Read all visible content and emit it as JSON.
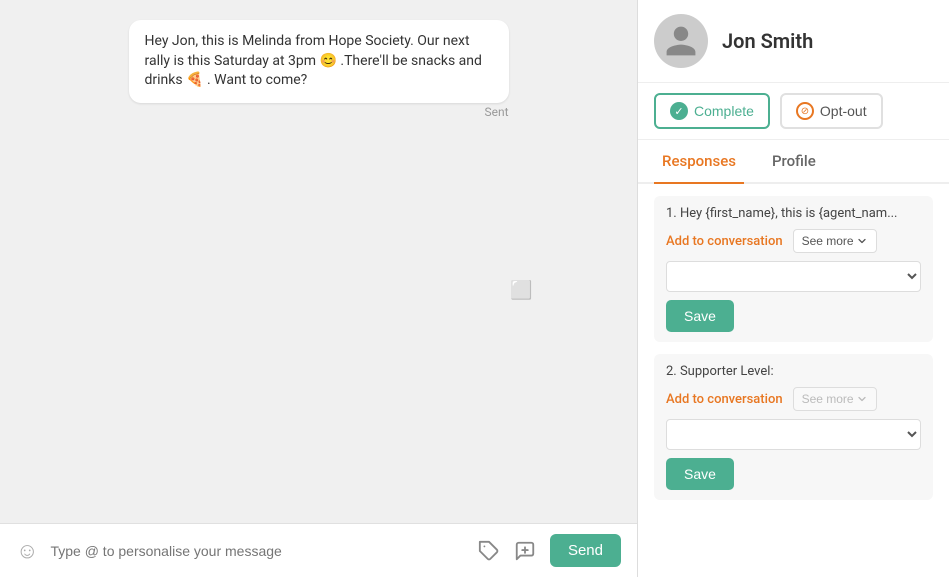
{
  "chat": {
    "message_text": "Hey Jon, this is Melinda from Hope Society. Our next rally is this Saturday at 3pm 😊 .There'll be snacks and drinks 🍕 . Want to come?",
    "sent_label": "Sent",
    "input_placeholder": "Type @ to personalise your message",
    "send_button_label": "Send"
  },
  "contact": {
    "name": "Jon Smith",
    "complete_button_label": "Complete",
    "optout_button_label": "Opt-out"
  },
  "tabs": {
    "responses_label": "Responses",
    "profile_label": "Profile"
  },
  "responses": {
    "item1": {
      "label": "1. Hey {first_name}, this is {agent_nam...",
      "add_to_conversation": "Add to conversation",
      "see_more": "See more",
      "save_label": "Save"
    },
    "item2": {
      "label": "2. Supporter Level:",
      "add_to_conversation": "Add to conversation",
      "see_more": "See more",
      "save_label": "Save"
    }
  }
}
